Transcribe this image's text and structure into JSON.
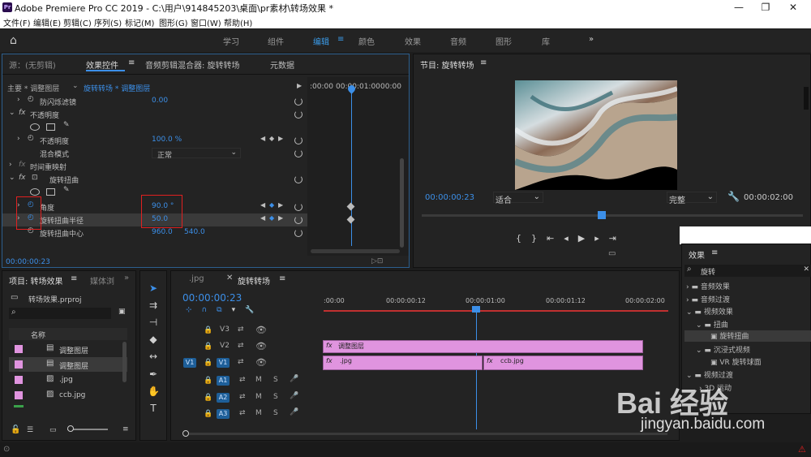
{
  "window": {
    "title": "Adobe Premiere Pro CC 2019 - C:\\用户\\914845203\\桌面\\pr素材\\转场效果 *",
    "app_icon": "Pr"
  },
  "menu": [
    "文件(F)",
    "编辑(E)",
    "剪辑(C)",
    "序列(S)",
    "标记(M)",
    "图形(G)",
    "窗口(W)",
    "帮助(H)"
  ],
  "workspaces": [
    "学习",
    "组件",
    "编辑",
    "颜色",
    "效果",
    "音频",
    "图形",
    "库"
  ],
  "effect_controls": {
    "tabs": [
      "源：(无剪辑)",
      "效果控件",
      "音频剪辑混合器: 旋转转场",
      "元数据"
    ],
    "clip_path": "主要 * 调整图层",
    "clip_target": "旋转转场 * 调整图层",
    "ruler": [
      ":00:00",
      "00:00:01:00",
      "00:00"
    ],
    "rows": {
      "anti_flicker": "防闪烁滤镜",
      "anti_flicker_val": "0.00",
      "opacity_group": "不透明度",
      "opacity": "不透明度",
      "opacity_val": "100.0 %",
      "blend": "混合模式",
      "blend_val": "正常",
      "time_remap": "时间重映射",
      "twirl_group": "旋转扭曲",
      "angle": "角度",
      "angle_val": "90.0 °",
      "radius": "旋转扭曲半径",
      "radius_val": "50.0",
      "center": "旋转扭曲中心",
      "center_x": "960.0",
      "center_y": "540.0"
    },
    "timecode": "00:00:00:23"
  },
  "program": {
    "title": "节目: 旋转转场",
    "timecode": "00:00:00:23",
    "fit": "适合",
    "quality": "完整",
    "duration": "00:00:02:00"
  },
  "effects_panel": {
    "title": "效果",
    "search": "旋转",
    "tree": [
      {
        "label": "音频效果",
        "level": 0
      },
      {
        "label": "音频过渡",
        "level": 0
      },
      {
        "label": "视频效果",
        "level": 0
      },
      {
        "label": "扭曲",
        "level": 1
      },
      {
        "label": "旋转扭曲",
        "level": 2
      },
      {
        "label": "沉浸式视频",
        "level": 1
      },
      {
        "label": "VR 旋转球面",
        "level": 2
      },
      {
        "label": "视频过渡",
        "level": 0
      },
      {
        "label": "3D 运动",
        "level": 1
      }
    ]
  },
  "project": {
    "tabs": [
      "项目: 转场效果",
      "媒体浏"
    ],
    "file": "转场效果.prproj",
    "column": "名称",
    "items": [
      "调整图层",
      "调整图层",
      ".jpg",
      "ccb.jpg"
    ]
  },
  "timeline": {
    "tabs": [
      ".jpg",
      "旋转转场"
    ],
    "timecode": "00:00:00:23",
    "ruler": [
      ":00:00",
      "00:00:00:12",
      "00:00:01:00",
      "00:00:01:12",
      "00:00:02:00"
    ],
    "tracks": [
      "V3",
      "V2",
      "V1",
      "A1",
      "A2",
      "A3"
    ],
    "source_v1": "V1",
    "clips": {
      "adjust": "调整图层",
      "jpg": ".jpg",
      "ccb": "ccb.jpg"
    }
  },
  "watermark": {
    "brand": "Bai 经验",
    "url": "jingyan.baidu.com"
  },
  "colors": {
    "accent": "#3c8fe8",
    "clip": "#e094df",
    "highlight": "#e02020",
    "bg": "#232323"
  }
}
